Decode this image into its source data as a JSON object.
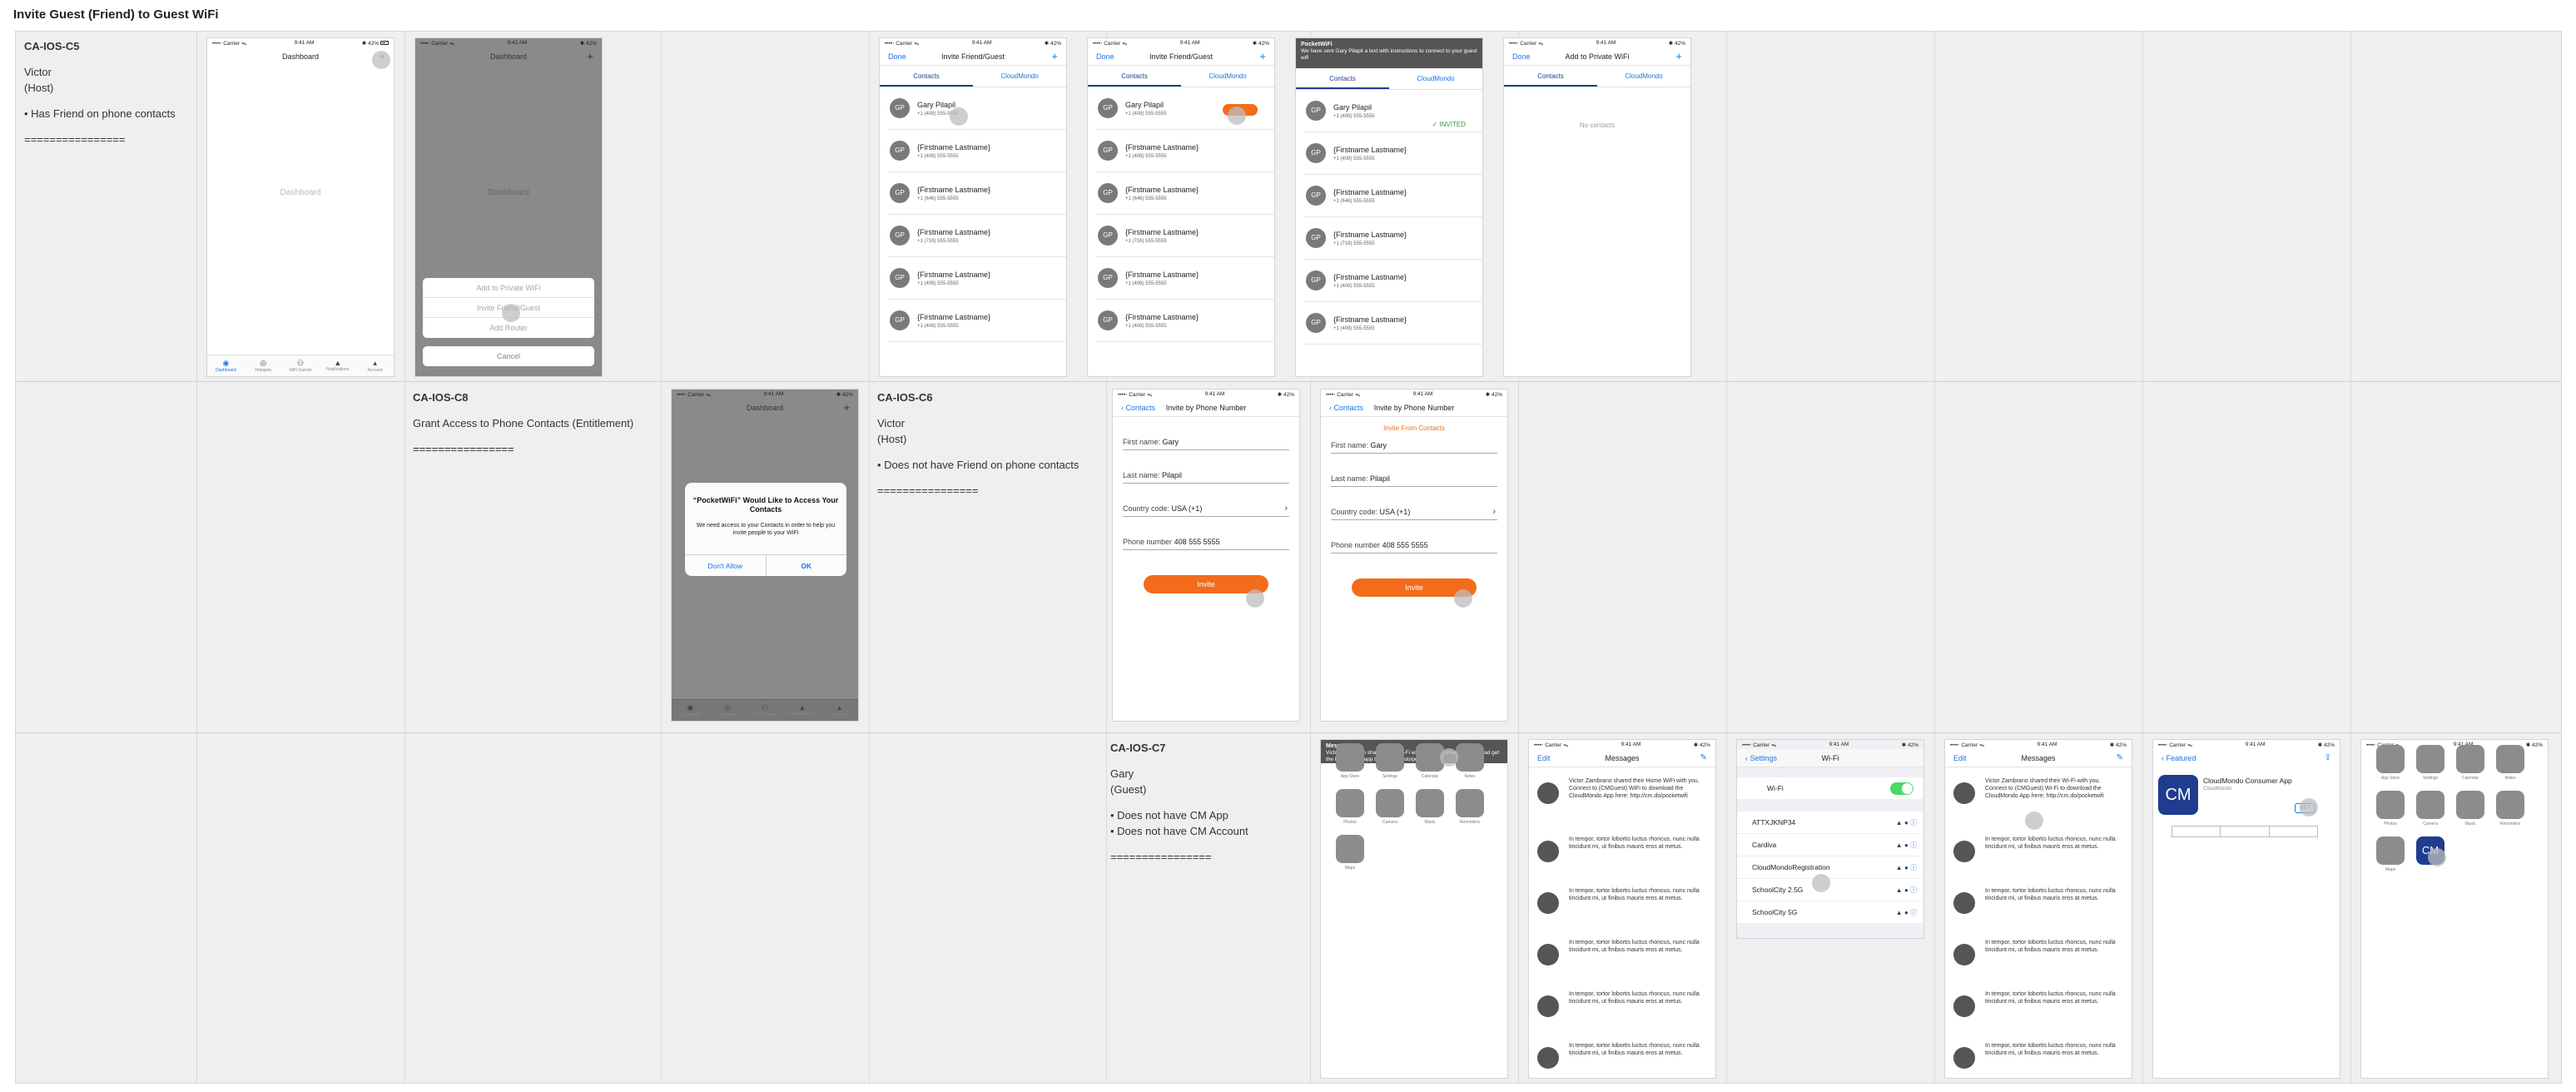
{
  "page_title": "Invite Guest (Friend) to Guest WiFi",
  "status": {
    "carrier": "••••◦ Carrier ᯓ",
    "time": "9:41 AM",
    "battery": "✱ 42%"
  },
  "notes": {
    "c5": {
      "heading": "CA-IOS-C5",
      "lines": [
        "Victor",
        "(Host)",
        "",
        "• Has Friend on phone contacts",
        "",
        "================"
      ]
    },
    "c8": {
      "heading": "CA-IOS-C8",
      "lines": [
        "Grant Access to Phone Contacts (Entitlement)",
        "",
        "================"
      ]
    },
    "c6": {
      "heading": "CA-IOS-C6",
      "lines": [
        "Victor",
        "(Host)",
        "",
        "• Does not have Friend on phone contacts",
        "",
        "================"
      ]
    },
    "c7": {
      "heading": "CA-IOS-C7",
      "lines": [
        "Gary",
        "(Guest)",
        "",
        "• Does not have CM App",
        "• Does not have CM Account",
        "",
        "================"
      ]
    }
  },
  "dashboard": {
    "title": "Dashboard",
    "placeholder": "Dashboard",
    "plus": "+",
    "tabs": [
      {
        "icon": "◉",
        "label": "Dashboard"
      },
      {
        "icon": "◎",
        "label": "Hotspots"
      },
      {
        "icon": "⚇",
        "label": "WiFi Guests"
      },
      {
        "icon": "▲",
        "label": "Notifications"
      },
      {
        "icon": "▴",
        "label": "Account"
      }
    ]
  },
  "sheet": {
    "items": [
      "Add to Private WiFi",
      "Invite Friend/Guest",
      "Add Router"
    ],
    "cancel": "Cancel"
  },
  "invite": {
    "title": "Invite Friend/Guest",
    "done": "Done",
    "plus": "+",
    "tab_contacts": "Contacts",
    "tab_cm": "CloudMondo",
    "contacts": [
      {
        "initials": "GP",
        "name": "Gary Pilapil",
        "phone": "+1 (408) 555-5555"
      },
      {
        "initials": "GP",
        "name": "{Firstname Lastname}",
        "phone": "+1 (408) 555-5555"
      },
      {
        "initials": "GP",
        "name": "{Firstname Lastname}",
        "phone": "+1 (646) 555-5555"
      },
      {
        "initials": "GP",
        "name": "{Firstname Lastname}",
        "phone": "+1 (718) 555-5555"
      },
      {
        "initials": "GP",
        "name": "{Firstname Lastname}",
        "phone": "+1 (408) 555-5555"
      },
      {
        "initials": "GP",
        "name": "{Firstname Lastname}",
        "phone": "+1 (408) 555-5555"
      }
    ],
    "invited": "✓ INVITED",
    "banner_title": "PocketWiFi",
    "banner_text": "We have sent Gary Pilapil a text with instructions to connect to your guest wifi"
  },
  "private": {
    "title": "Add to Private WiFi",
    "done": "Done",
    "plus": "+",
    "empty": "No contacts"
  },
  "permission": {
    "title": "“PocketWiFi” Would Like to Access Your Contacts",
    "message": "We need access to your Contacts in order to help you invite people to your WiFi",
    "deny": "Don't Allow",
    "ok": "OK"
  },
  "phone_form": {
    "back": "Contacts",
    "title": "Invite by Phone Number",
    "from_contacts": "Invite From Contacts",
    "first_label": "First name:",
    "first_value": "Gary",
    "last_label": "Last name:",
    "last_value": "Pilapil",
    "country_label": "Country code:",
    "country_value": "USA (+1)",
    "phone_label": "Phone number",
    "phone_value": "408 555 5555",
    "button": "Invite"
  },
  "messages": {
    "title": "Messages",
    "edit": "Edit",
    "first": "Victor Zambrano shared their Home WiFi with you. Connect to (CMGuest) WiFi to download the CloudMondo App here: http://cm.do/pocketwifi",
    "first2": "Victor Zambrano shared their Wi-Fi with you. Connect to (CMGuest) Wi-Fi to download the CloudMondo App here: http://cm.do/pocketwifi",
    "lorem": "In tempor, tortor lobortis luctus rhoncus, nunc nulla tincidunt mi, ut finibus mauris eros at metus."
  },
  "home_banner": {
    "title": "Messages",
    "text": "Victor Zambrano shared their Wi-Fi with you. To connect & download get the PocketWiFi app tap here cm.do/pocketwifi"
  },
  "home": {
    "labels": [
      "App Store",
      "Settings",
      "Calendar",
      "Notes",
      "Photos",
      "Camera",
      "Music",
      "Reminders",
      "Maps"
    ]
  },
  "wifi": {
    "back": "Settings",
    "title": "Wi-Fi",
    "wifi_label": "Wi-Fi",
    "networks": [
      "ATTXJKNP34",
      "Cardiva",
      "CloudMondoRegistration",
      "SchoolCity 2.5G",
      "SchoolCity 5G"
    ],
    "icons": "▲ ● ⓘ"
  },
  "store": {
    "back": "Featured",
    "app_name": "CloudMondo Consumer App",
    "publisher": "CloudMondo",
    "logo": "CM",
    "get": "GET"
  }
}
